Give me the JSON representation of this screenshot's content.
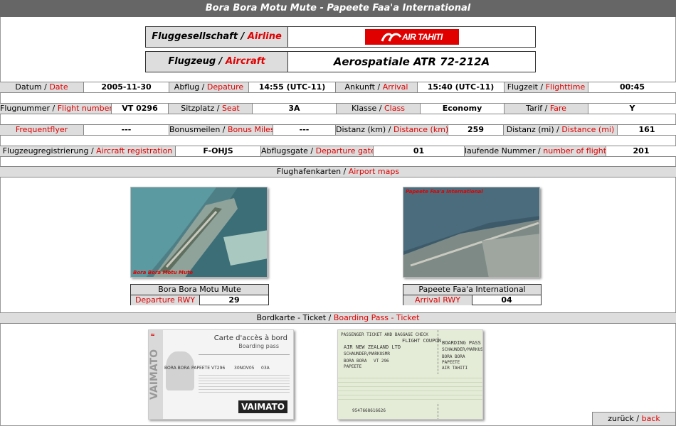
{
  "title": "Bora Bora Motu Mute - Papeete Faa'a International",
  "airline": {
    "label_de": "Fluggesellschaft",
    "label_en": "Airline",
    "logo_text": "AIR TAHITI"
  },
  "aircraft": {
    "label_de": "Flugzeug",
    "label_en": "Aircraft",
    "value": "Aerospatiale ATR 72-212A"
  },
  "sep": " / ",
  "rows": {
    "r1": [
      {
        "de": "Datum",
        "en": "Date",
        "value": "2005-11-30"
      },
      {
        "de": "Abflug",
        "en": "Depature",
        "value": "14:55 (UTC-11)"
      },
      {
        "de": "Ankunft",
        "en": "Arrival",
        "value": "15:40 (UTC-11)"
      },
      {
        "de": "Flugzeit",
        "en": "Flighttime",
        "value": "00:45"
      }
    ],
    "r2": [
      {
        "de": "Flugnummer",
        "en": "Flight number",
        "value": "VT 0296"
      },
      {
        "de": "Sitzplatz",
        "en": "Seat",
        "value": "3A"
      },
      {
        "de": "Klasse",
        "en": "Class",
        "value": "Economy"
      },
      {
        "de": "Tarif",
        "en": "Fare",
        "value": "Y"
      }
    ],
    "r3": [
      {
        "de": "",
        "en": "Frequentflyer",
        "value": "---"
      },
      {
        "de": "Bonusmeilen",
        "en": "Bonus Miles",
        "value": "---"
      },
      {
        "de": "Distanz (km)",
        "en": "Distance (km)",
        "value": "259"
      },
      {
        "de": "Distanz (mi)",
        "en": "Distance (mi)",
        "value": "161"
      }
    ],
    "r4": [
      {
        "de": "Flugzeugregistrierung",
        "en": "Aircraft registration",
        "value": "F-OHJS"
      },
      {
        "de": "Abflugsgate",
        "en": "Departure gate",
        "value": "01"
      },
      {
        "de": "laufende Nummer",
        "en": "number of flights",
        "value": "201"
      }
    ]
  },
  "maps_section": {
    "de": "Flughafenkarten",
    "en": "Airport maps"
  },
  "departure_map": {
    "overlay": "Bora Bora Motu Mute",
    "name": "Bora Bora Motu Mute",
    "rwy_label": "Departure RWY",
    "rwy": "29"
  },
  "arrival_map": {
    "overlay": "Papeete Faa'a International",
    "name": "Papeete Faa'a International",
    "rwy_label": "Arrival RWY",
    "rwy": "04"
  },
  "ticket_section": {
    "de": "Bordkarte - Ticket",
    "en": "Boarding Pass - Ticket"
  },
  "ticket1": {
    "title_fr": "Carte d'accès à bord",
    "title_en": "Boarding pass",
    "side": "VAIMATO",
    "brand": "VAIMATO",
    "flight": "VT296",
    "date": "30NOV05",
    "from": "BORA BORA",
    "to": "PAPEETE",
    "seat": "03A"
  },
  "ticket2": {
    "header": "PASSENGER TICKET AND BAGGAGE CHECK",
    "coupon": "FLIGHT COUPON",
    "bp": "BOARDING PASS",
    "carrier": "AIR NEW ZEALAND LTD",
    "name": "SCHAUNDER/MARKUSMR",
    "route1": "BORA BORA",
    "route2": "PAPEETE",
    "flight": "VT 296",
    "airline": "AIR TAHITI",
    "number": "9547668616626"
  },
  "back": {
    "de": "zurück",
    "en": "back"
  },
  "colors": {
    "accent": "#e00000",
    "header_bg": "#666666",
    "label_bg": "#dddddd"
  }
}
